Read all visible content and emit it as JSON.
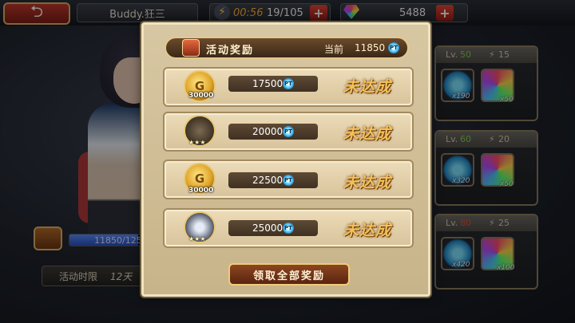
{
  "topbar": {
    "back_icon": "back-arrow-icon",
    "player_name": "Buddy.狂三",
    "energy_icon": "lightning-bolt-icon",
    "timer": "00:56",
    "energy": "19/105",
    "gems": "5488",
    "plus": "+"
  },
  "background": {
    "progress_text": "11850/125",
    "progress_fraction": 0.95,
    "time_limit_label": "活动时限",
    "time_limit_value": "12天",
    "side_panels": [
      {
        "lv_label": "Lv.",
        "lv": "50",
        "bolt": "15",
        "pt_qty": "x190",
        "gem_qty": "x50"
      },
      {
        "lv_label": "Lv.",
        "lv": "60",
        "bolt": "20",
        "pt_qty": "x320",
        "gem_qty": "x50"
      },
      {
        "lv_label": "Lv.",
        "lv": "80",
        "bolt": "25",
        "pt_qty": "x420",
        "gem_qty": "x100"
      }
    ]
  },
  "modal": {
    "title": "活动奖励",
    "current_label": "当前",
    "current_value": "11850",
    "pt_label": "PT",
    "rows": [
      {
        "icon": "gold-coin-icon",
        "icon_text": "G",
        "qty": "30000",
        "stars": "",
        "requirement": "17500",
        "status": "未达成"
      },
      {
        "icon": "weapon-item-icon",
        "icon_text": "",
        "qty": "",
        "stars": "★★★",
        "requirement": "20000",
        "status": "未达成"
      },
      {
        "icon": "gold-coin-icon",
        "icon_text": "G",
        "qty": "30000",
        "stars": "",
        "requirement": "22500",
        "status": "未达成"
      },
      {
        "icon": "diamond-item-icon",
        "icon_text": "",
        "qty": "",
        "stars": "★★★",
        "requirement": "25000",
        "status": "未达成"
      }
    ],
    "claim_all": "领取全部奖励"
  },
  "colors": {
    "status": "#f4c15a",
    "modal_bg": "#d7c7a2",
    "energy_timer": "#ffb03a",
    "level_green": "#7fd34b",
    "level_red": "#e84b3a"
  }
}
